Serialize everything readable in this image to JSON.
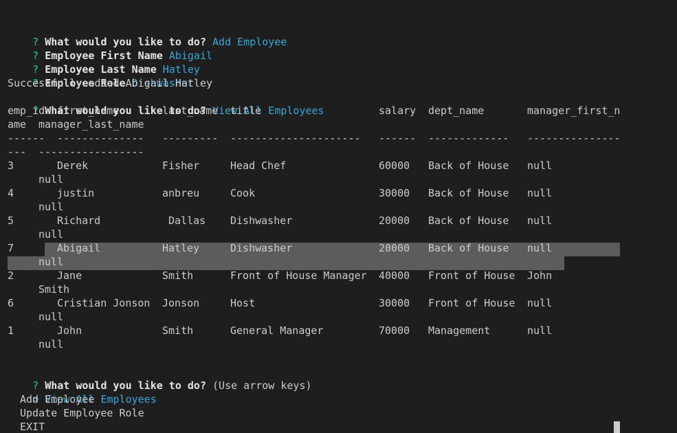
{
  "prompts": [
    {
      "mark": "?",
      "question": "What would you like to do?",
      "answer": "Add Employee"
    },
    {
      "mark": "?",
      "question": "Employee First Name",
      "answer": "Abigail"
    },
    {
      "mark": "?",
      "question": "Employee Last Name",
      "answer": "Hatley"
    },
    {
      "mark": "?",
      "question": "Employee Role",
      "answer": "Dishwasher"
    }
  ],
  "success_message": "Successfully added Abigail Hatley",
  "view_prompt": {
    "mark": "?",
    "question": "What would you like to do?",
    "answer": "View All Employees"
  },
  "table": {
    "headers": [
      "emp_id",
      "first_name",
      "last_name",
      "title",
      "salary",
      "dept_name",
      "manager_first_n"
    ],
    "header_wrap": [
      "ame",
      "manager_last_name"
    ],
    "separator": [
      "------",
      "--------------",
      "---------",
      "---------------------",
      "------",
      "-------------",
      "---------------"
    ],
    "separator_wrap": [
      "---",
      "-----------------"
    ],
    "rows": [
      {
        "id": "3",
        "first": "Derek",
        "last": "Fisher",
        "title": "Head Chef",
        "salary": "60000",
        "dept": "Back of House",
        "mgr_first": "null",
        "mgr_last": "null"
      },
      {
        "id": "4",
        "first": "justin",
        "last": "anbreu",
        "title": "Cook",
        "salary": "30000",
        "dept": "Back of House",
        "mgr_first": "null",
        "mgr_last": "null"
      },
      {
        "id": "5",
        "first": "Richard",
        "last": " Dallas",
        "title": "Dishwasher",
        "salary": "20000",
        "dept": "Back of House",
        "mgr_first": "null",
        "mgr_last": "null"
      },
      {
        "id": "7",
        "first": "Abigail",
        "last": "Hatley",
        "title": "Dishwasher",
        "salary": "20000",
        "dept": "Back of House",
        "mgr_first": "null",
        "mgr_last": "null"
      },
      {
        "id": "2",
        "first": "Jane",
        "last": "Smith",
        "title": "Front of House Manager",
        "salary": "40000",
        "dept": "Front of House",
        "mgr_first": "John",
        "mgr_last": "Smith"
      },
      {
        "id": "6",
        "first": "Cristian Jonson",
        "last": "Jonson",
        "title": "Host",
        "salary": "30000",
        "dept": "Front of House",
        "mgr_first": "null",
        "mgr_last": "null"
      },
      {
        "id": "1",
        "first": "John",
        "last": "Smith",
        "title": "General Manager",
        "salary": "70000",
        "dept": "Management",
        "mgr_first": "null",
        "mgr_last": "null"
      }
    ]
  },
  "menu_prompt": {
    "mark": "?",
    "question": "What would you like to do?",
    "hint": "(Use arrow keys)"
  },
  "menu": {
    "pointer": ">",
    "options": [
      "View All Employees",
      "Add Employee",
      "Update Employee Role",
      "EXIT"
    ]
  }
}
